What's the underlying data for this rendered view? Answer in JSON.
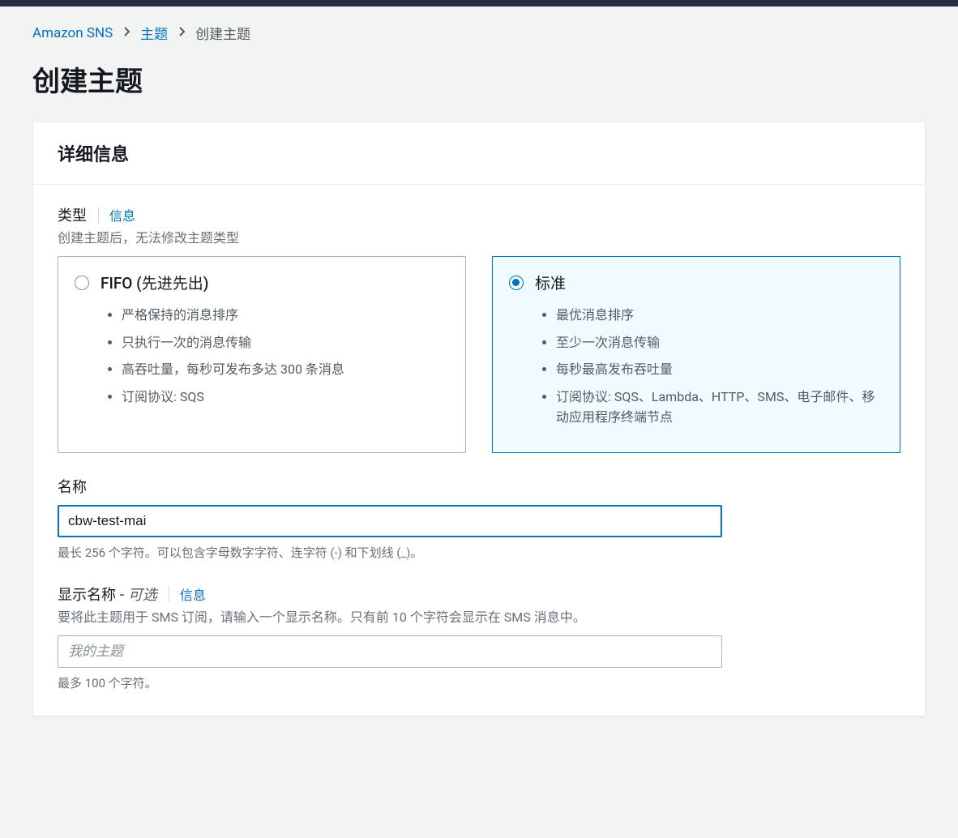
{
  "breadcrumb": {
    "items": [
      {
        "label": "Amazon SNS"
      },
      {
        "label": "主题"
      }
    ],
    "current": "创建主题"
  },
  "page": {
    "title": "创建主题"
  },
  "panel": {
    "header": "详细信息"
  },
  "typeField": {
    "label": "类型",
    "infoLink": "信息",
    "description": "创建主题后，无法修改主题类型",
    "options": {
      "fifo": {
        "title": "FIFO (先进先出)",
        "bullets": [
          "严格保持的消息排序",
          "只执行一次的消息传输",
          "高吞吐量，每秒可发布多达 300 条消息",
          "订阅协议: SQS"
        ],
        "selected": false
      },
      "standard": {
        "title": "标准",
        "bullets": [
          "最优消息排序",
          "至少一次消息传输",
          "每秒最高发布吞吐量",
          "订阅协议: SQS、Lambda、HTTP、SMS、电子邮件、移动应用程序终端节点"
        ],
        "selected": true
      }
    }
  },
  "nameField": {
    "label": "名称",
    "value": "cbw-test-mai",
    "hint": "最长 256 个字符。可以包含字母数字字符、连字符 (-) 和下划线 (_)。"
  },
  "displayNameField": {
    "label": "显示名称",
    "optional": "- 可选",
    "infoLink": "信息",
    "description": "要将此主题用于 SMS 订阅，请输入一个显示名称。只有前 10 个字符会显示在 SMS 消息中。",
    "placeholder": "我的主题",
    "value": "",
    "hint": "最多 100 个字符。"
  }
}
